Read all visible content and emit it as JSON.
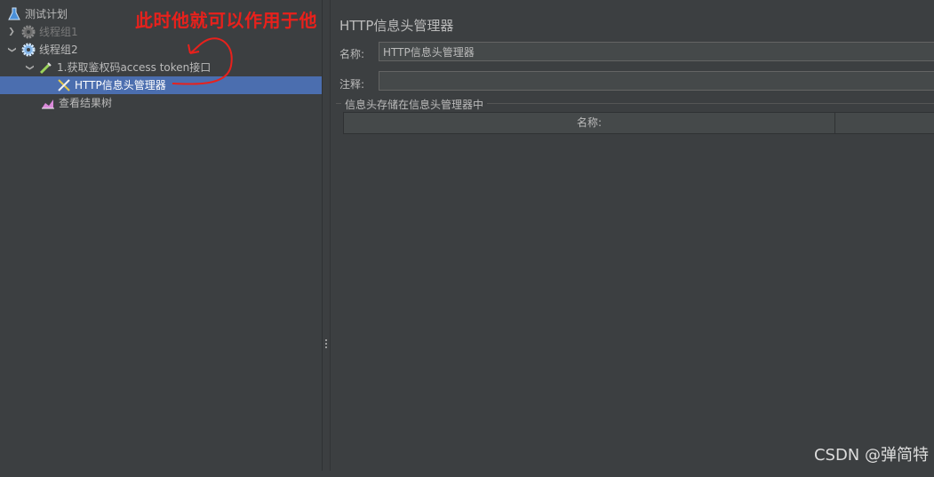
{
  "tree": {
    "items": [
      {
        "label": "测试计划",
        "icon": "flask-icon"
      },
      {
        "label": "线程组1",
        "icon": "gear-icon",
        "disabled": true
      },
      {
        "label": "线程组2",
        "icon": "gear-icon"
      },
      {
        "label": "1.获取鉴权码access token接口",
        "icon": "pipette-icon"
      },
      {
        "label": "HTTP信息头管理器",
        "icon": "wrench-icon",
        "selected": true
      },
      {
        "label": "查看结果树",
        "icon": "chart-icon"
      }
    ]
  },
  "annotation": {
    "text": "此时他就可以作用于他",
    "color": "#e8211c"
  },
  "panel": {
    "title": "HTTP信息头管理器",
    "name_label": "名称:",
    "name_value": "HTTP信息头管理器",
    "comment_label": "注释:",
    "comment_value": "",
    "group_title": "信息头存储在信息头管理器中",
    "table_headers": [
      "名称:",
      ""
    ]
  },
  "watermark": "CSDN @弹简特",
  "colors": {
    "background": "#3c3f41",
    "selection": "#4b6eaf",
    "annotation": "#e8211c"
  }
}
